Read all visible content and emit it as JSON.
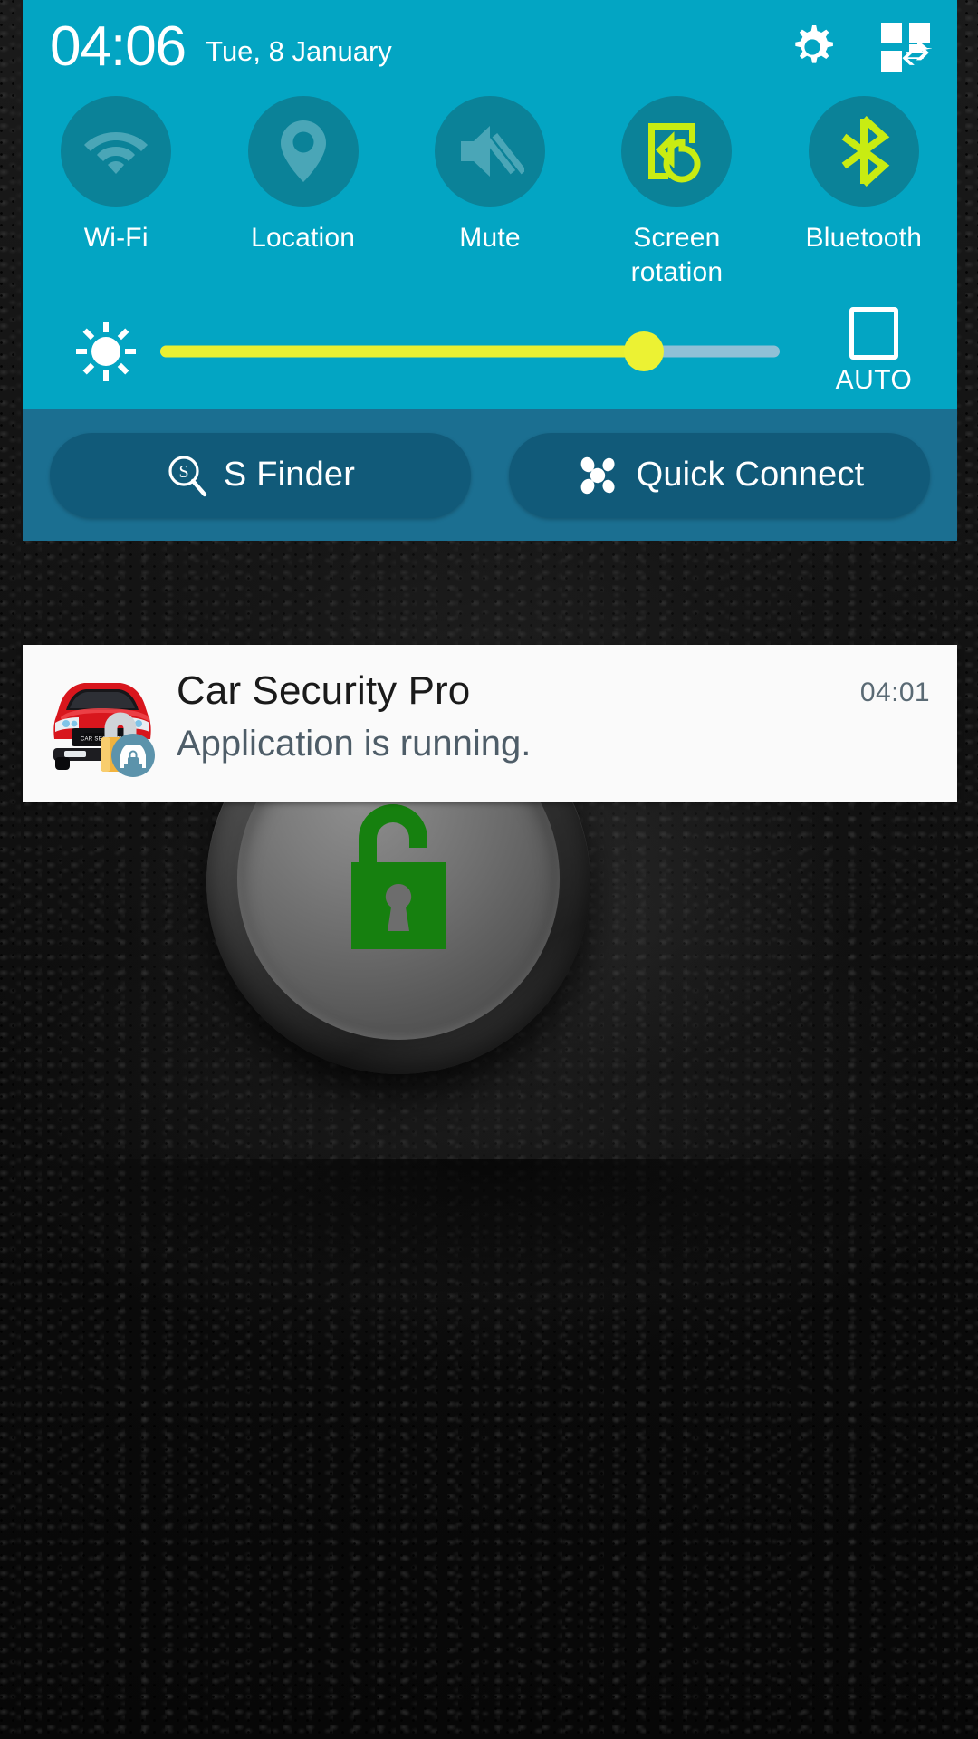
{
  "statusbar": {
    "clock": "04:06",
    "date": "Tue, 8 January",
    "settings_icon": "gear-icon",
    "edit_icon": "quick-settings-edit-icon"
  },
  "quick_settings": {
    "toggles": [
      {
        "label": "Wi-Fi",
        "icon": "wifi-icon",
        "active": false
      },
      {
        "label": "Location",
        "icon": "location-pin-icon",
        "active": false
      },
      {
        "label": "Mute",
        "icon": "mute-icon",
        "active": false
      },
      {
        "label": "Screen\nrotation",
        "icon": "screen-rotation-icon",
        "active": true
      },
      {
        "label": "Bluetooth",
        "icon": "bluetooth-icon",
        "active": true
      }
    ],
    "brightness": {
      "icon": "brightness-sun-icon",
      "value_percent": 78,
      "auto_label": "AUTO",
      "auto_checked": false
    },
    "actions": [
      {
        "label": "S Finder",
        "icon": "s-finder-search-icon"
      },
      {
        "label": "Quick Connect",
        "icon": "quick-connect-icon"
      }
    ]
  },
  "notification": {
    "app_icon": "car-security-app-icon",
    "title": "Car Security Pro",
    "text": "Application is running.",
    "time": "04:01"
  },
  "home": {
    "lock_button_icon": "unlocked-padlock-icon",
    "lock_state": "unlocked"
  },
  "colors": {
    "panel_cyan": "#03a5c3",
    "toggle_circle": "#0b8298",
    "toggle_inactive_icon": "#4aa6b7",
    "toggle_active_icon": "#c8ec12",
    "action_strip": "#1b6f91",
    "action_button": "#115a79",
    "slider_fill": "#e9f032",
    "slider_track": "#8fc0d6",
    "notification_bg": "#fafafa",
    "notification_time": "#5a6a74",
    "lock_green": "#16800f"
  }
}
